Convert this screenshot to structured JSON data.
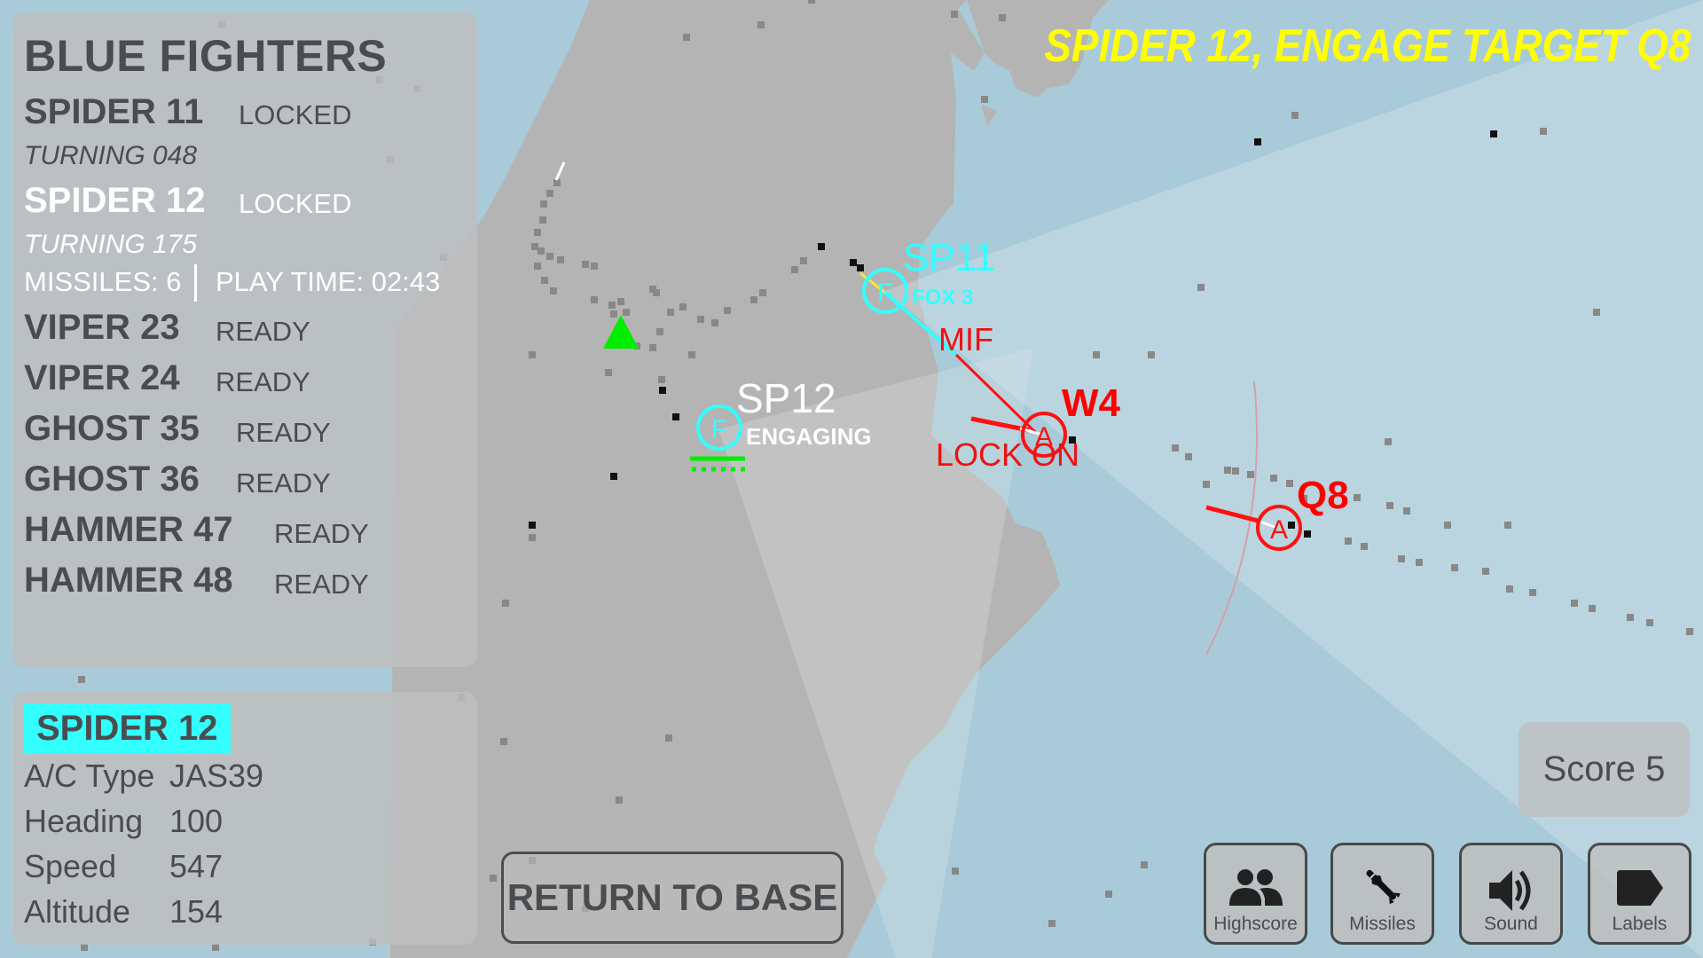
{
  "banner": {
    "text": "SPIDER 12, ENGAGE TARGET Q8",
    "color": "#ffff00"
  },
  "fighters_panel": {
    "title": "BLUE FIGHTERS",
    "fighters": [
      {
        "callsign": "SPIDER 11",
        "status": "LOCKED",
        "sub": "TURNING 048",
        "selected": false
      },
      {
        "callsign": "SPIDER 12",
        "status": "LOCKED",
        "sub": "TURNING 175",
        "selected": true,
        "missiles": "MISSILES: 6",
        "play_time": "PLAY TIME: 02:43"
      },
      {
        "callsign": "VIPER 23",
        "status": "READY"
      },
      {
        "callsign": "VIPER 24",
        "status": "READY"
      },
      {
        "callsign": "GHOST 35",
        "status": "READY"
      },
      {
        "callsign": "GHOST 36",
        "status": "READY"
      },
      {
        "callsign": "HAMMER 47",
        "status": "READY"
      },
      {
        "callsign": "HAMMER 48",
        "status": "READY"
      }
    ]
  },
  "detail_panel": {
    "selected": "SPIDER 12",
    "rows": [
      {
        "label": "A/C Type",
        "value": "JAS39"
      },
      {
        "label": "Heading",
        "value": "100"
      },
      {
        "label": "Speed",
        "value": "547"
      },
      {
        "label": "Altitude",
        "value": "154"
      }
    ],
    "highlight_color": "#33ffff"
  },
  "return_button": {
    "label": "RETURN TO BASE"
  },
  "score": {
    "label": "Score 5"
  },
  "toolbar": [
    {
      "label": "Highscore",
      "icon": "people-icon"
    },
    {
      "label": "Missiles",
      "icon": "missile-icon"
    },
    {
      "label": "Sound",
      "icon": "speaker-icon"
    },
    {
      "label": "Labels",
      "icon": "label-tag-icon"
    }
  ],
  "map": {
    "friendlies": [
      {
        "id": "SP11",
        "symbol": "F",
        "status": "FOX 3",
        "color": "#33ffff"
      },
      {
        "id": "SP12",
        "symbol": "F",
        "status": "ENGAGING",
        "color": "#ffffff"
      }
    ],
    "hostiles": [
      {
        "id": "W4",
        "symbol": "A",
        "status": "LOCK ON",
        "color": "#ff0000"
      },
      {
        "id": "Q8",
        "symbol": "A",
        "status": "",
        "color": "#ff0000"
      }
    ],
    "missile_label": "MIF",
    "colors": {
      "sea": "#a9cbd9",
      "land": "#b4b4b4",
      "friendly": "#33ffff",
      "hostile": "#ff0000",
      "base": "#00ee00"
    }
  }
}
